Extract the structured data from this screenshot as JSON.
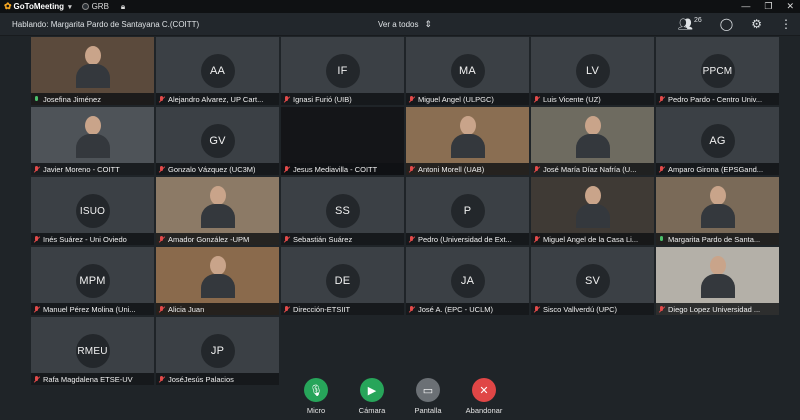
{
  "app": {
    "logo": "GoToMeeting",
    "badge": "GRB"
  },
  "header": {
    "speaking": "Hablando: Margarita Pardo de Santayana C.(COITT)",
    "view_selector": "Ver a todos",
    "attendee_count": "26"
  },
  "participants": [
    {
      "name": "Josefina Jiménez",
      "initials": "",
      "mic": "on",
      "kind": "video",
      "bg": "#5b4a3c"
    },
    {
      "name": "Alejandro Alvarez, UP Cart...",
      "initials": "AA",
      "mic": "off",
      "kind": "avatar"
    },
    {
      "name": "Ignasi Furió (UIB)",
      "initials": "IF",
      "mic": "off",
      "kind": "avatar"
    },
    {
      "name": "Miguel Angel (ULPGC)",
      "initials": "MA",
      "mic": "off",
      "kind": "avatar"
    },
    {
      "name": "Luis Vicente (UZ)",
      "initials": "LV",
      "mic": "off",
      "kind": "avatar"
    },
    {
      "name": "Pedro Pardo - Centro Univ...",
      "initials": "PPCM",
      "mic": "off",
      "kind": "avatar"
    },
    {
      "name": "Javier Moreno - COITT",
      "initials": "",
      "mic": "off",
      "kind": "video",
      "bg": "#4e5358"
    },
    {
      "name": "Gonzalo Vázquez (UC3M)",
      "initials": "GV",
      "mic": "off",
      "kind": "avatar"
    },
    {
      "name": "Jesus Mediavilla - COITT",
      "initials": "",
      "mic": "off",
      "kind": "dark"
    },
    {
      "name": "Antoni Morell (UAB)",
      "initials": "",
      "mic": "off",
      "kind": "video",
      "bg": "#8a6e52"
    },
    {
      "name": "José María Díaz Nafría (U...",
      "initials": "",
      "mic": "off",
      "kind": "video",
      "bg": "#6e6b60"
    },
    {
      "name": "Amparo Girona (EPSGand...",
      "initials": "AG",
      "mic": "off",
      "kind": "avatar"
    },
    {
      "name": "Inés Suárez - Uni Oviedo",
      "initials": "ISUO",
      "mic": "off",
      "kind": "avatar"
    },
    {
      "name": "Amador González -UPM",
      "initials": "",
      "mic": "off",
      "kind": "video",
      "bg": "#8c7a66"
    },
    {
      "name": "Sebastián Suárez",
      "initials": "SS",
      "mic": "off",
      "kind": "avatar"
    },
    {
      "name": "Pedro (Universidad de Ext...",
      "initials": "P",
      "mic": "off",
      "kind": "avatar"
    },
    {
      "name": "Miguel Angel de la Casa Li...",
      "initials": "",
      "mic": "off",
      "kind": "video",
      "bg": "#3f3a35"
    },
    {
      "name": "Margarita Pardo de Santa...",
      "initials": "",
      "mic": "on",
      "kind": "video",
      "bg": "#7a6a58"
    },
    {
      "name": "Manuel Pérez Molina (Uni...",
      "initials": "MPM",
      "mic": "off",
      "kind": "avatar"
    },
    {
      "name": "Alicia Juan",
      "initials": "",
      "mic": "off",
      "kind": "video",
      "bg": "#8a6a4c"
    },
    {
      "name": "Dirección-ETSIIT",
      "initials": "DE",
      "mic": "off",
      "kind": "avatar"
    },
    {
      "name": "José A. (EPC - UCLM)",
      "initials": "JA",
      "mic": "off",
      "kind": "avatar"
    },
    {
      "name": "Sisco Vallverdú (UPC)",
      "initials": "SV",
      "mic": "off",
      "kind": "avatar"
    },
    {
      "name": "Diego Lopez Universidad ...",
      "initials": "",
      "mic": "off",
      "kind": "video",
      "bg": "#b4b0a8"
    },
    {
      "name": "Rafa Magdalena ETSE-UV",
      "initials": "RMEU",
      "mic": "off",
      "kind": "avatar"
    },
    {
      "name": "JoséJesús Palacios",
      "initials": "JP",
      "mic": "off",
      "kind": "avatar"
    }
  ],
  "controls": {
    "mic": "Micro",
    "camera": "Cámara",
    "screen": "Pantalla",
    "leave": "Abandonar"
  }
}
